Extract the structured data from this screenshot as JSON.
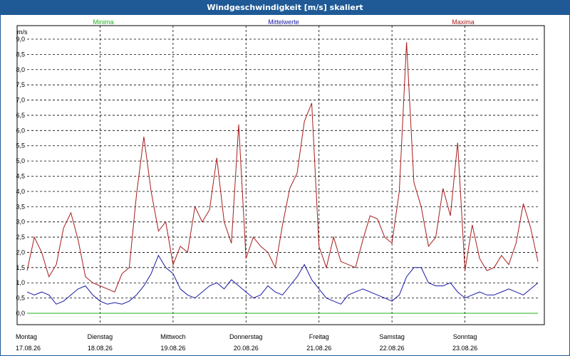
{
  "window": {
    "title": "Windgeschwindigkeit [m/s] skaliert"
  },
  "chart_data": {
    "type": "line",
    "ylabel": "m/s",
    "ylim": [
      0,
      9.0
    ],
    "yticks": [
      "0,0",
      "0,5",
      "1,0",
      "1,5",
      "2,0",
      "2,5",
      "3,0",
      "3,5",
      "4,0",
      "4,5",
      "5,0",
      "5,5",
      "6,0",
      "6,5",
      "7,0",
      "7,5",
      "8,0",
      "8,5",
      "9,0"
    ],
    "x_range_days": [
      0,
      7
    ],
    "days": [
      {
        "weekday": "Montag",
        "date": "17.08.26"
      },
      {
        "weekday": "Dienstag",
        "date": "18.08.26"
      },
      {
        "weekday": "Mittwoch",
        "date": "19.08.26"
      },
      {
        "weekday": "Donnerstag",
        "date": "20.08.26"
      },
      {
        "weekday": "Freitag",
        "date": "21.08.26"
      },
      {
        "weekday": "Samstag",
        "date": "22.08.26"
      },
      {
        "weekday": "Sonntag",
        "date": "23.08.26"
      }
    ],
    "grid": true,
    "series": [
      {
        "name": "Minima",
        "color": "#1db31d",
        "x": [
          0,
          7
        ],
        "y": [
          0.0,
          0.0
        ]
      },
      {
        "name": "Mittelwerte",
        "color": "#1a1aa6",
        "x": [
          0,
          0.1,
          0.2,
          0.3,
          0.4,
          0.5,
          0.6,
          0.7,
          0.8,
          0.9,
          1.0,
          1.1,
          1.2,
          1.3,
          1.4,
          1.5,
          1.6,
          1.7,
          1.8,
          1.9,
          2.0,
          2.1,
          2.2,
          2.3,
          2.4,
          2.5,
          2.6,
          2.7,
          2.8,
          2.9,
          3.0,
          3.1,
          3.2,
          3.3,
          3.4,
          3.5,
          3.6,
          3.7,
          3.8,
          3.9,
          4.0,
          4.1,
          4.2,
          4.3,
          4.4,
          4.5,
          4.6,
          4.7,
          4.8,
          4.9,
          5.0,
          5.1,
          5.2,
          5.3,
          5.4,
          5.5,
          5.6,
          5.7,
          5.8,
          5.9,
          6.0,
          6.1,
          6.2,
          6.3,
          6.4,
          6.5,
          6.6,
          6.7,
          6.8,
          6.9,
          7.0
        ],
        "y": [
          0.7,
          0.6,
          0.7,
          0.6,
          0.3,
          0.4,
          0.6,
          0.8,
          0.9,
          0.6,
          0.4,
          0.3,
          0.35,
          0.3,
          0.4,
          0.6,
          0.9,
          1.3,
          1.9,
          1.5,
          1.3,
          0.8,
          0.6,
          0.5,
          0.7,
          0.9,
          1.0,
          0.8,
          1.1,
          0.9,
          0.7,
          0.5,
          0.6,
          0.9,
          0.7,
          0.6,
          0.9,
          1.2,
          1.6,
          1.1,
          0.8,
          0.5,
          0.4,
          0.3,
          0.6,
          0.7,
          0.8,
          0.7,
          0.6,
          0.5,
          0.4,
          0.6,
          1.2,
          1.5,
          1.5,
          1.0,
          0.9,
          0.9,
          1.0,
          0.7,
          0.5,
          0.6,
          0.7,
          0.6,
          0.6,
          0.7,
          0.8,
          0.7,
          0.6,
          0.8,
          1.0
        ]
      },
      {
        "name": "Maxima",
        "color": "#a81c1c",
        "x": [
          0,
          0.1,
          0.2,
          0.3,
          0.4,
          0.5,
          0.6,
          0.7,
          0.8,
          0.9,
          1.0,
          1.1,
          1.2,
          1.3,
          1.4,
          1.5,
          1.6,
          1.7,
          1.8,
          1.9,
          2.0,
          2.1,
          2.2,
          2.3,
          2.4,
          2.5,
          2.6,
          2.7,
          2.8,
          2.9,
          3.0,
          3.1,
          3.2,
          3.3,
          3.4,
          3.5,
          3.6,
          3.7,
          3.8,
          3.9,
          4.0,
          4.1,
          4.2,
          4.3,
          4.4,
          4.5,
          4.6,
          4.7,
          4.8,
          4.9,
          5.0,
          5.1,
          5.2,
          5.3,
          5.4,
          5.5,
          5.6,
          5.7,
          5.8,
          5.9,
          6.0,
          6.1,
          6.2,
          6.3,
          6.4,
          6.5,
          6.6,
          6.7,
          6.8,
          6.9,
          7.0
        ],
        "y": [
          1.4,
          2.5,
          2.0,
          1.2,
          1.6,
          2.8,
          3.3,
          2.4,
          1.2,
          1.0,
          0.9,
          0.8,
          0.7,
          1.3,
          1.5,
          3.9,
          5.8,
          4.0,
          2.7,
          3.0,
          1.6,
          2.2,
          2.0,
          3.5,
          3.0,
          3.4,
          5.1,
          3.0,
          2.3,
          6.2,
          1.8,
          2.5,
          2.2,
          2.0,
          1.5,
          2.9,
          4.1,
          4.6,
          6.3,
          6.9,
          2.2,
          1.5,
          2.5,
          1.7,
          1.6,
          1.5,
          2.4,
          3.2,
          3.1,
          2.5,
          2.3,
          4.0,
          8.9,
          4.3,
          3.5,
          2.2,
          2.5,
          4.1,
          3.2,
          5.6,
          1.4,
          2.9,
          1.8,
          1.4,
          1.5,
          1.9,
          1.6,
          2.3,
          3.6,
          2.8,
          1.7
        ]
      }
    ]
  }
}
